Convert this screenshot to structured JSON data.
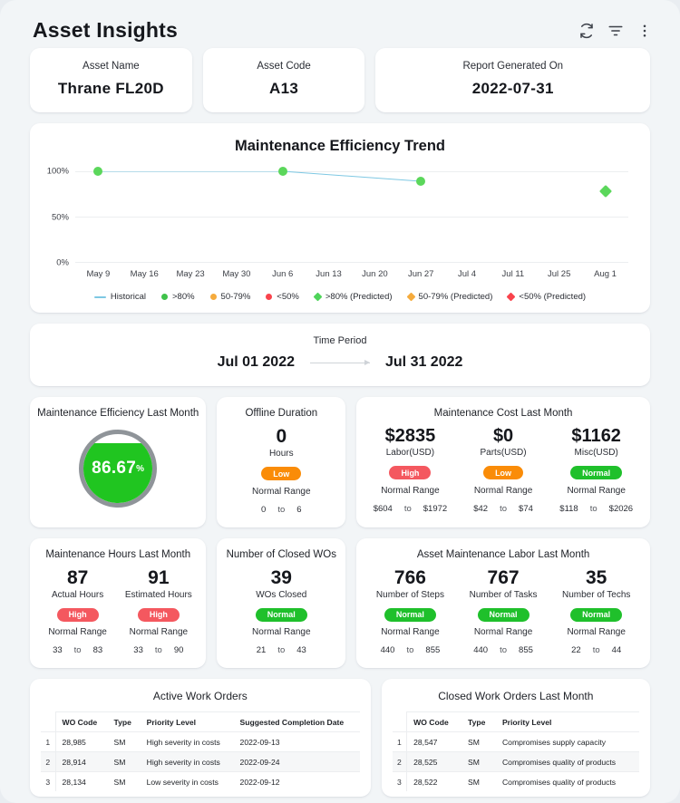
{
  "header": {
    "title": "Asset Insights",
    "actions": [
      {
        "name": "refresh-icon",
        "label": "Refresh"
      },
      {
        "name": "filter-icon",
        "label": "Filter"
      },
      {
        "name": "more-options-icon",
        "label": "More options"
      }
    ]
  },
  "info_cards": [
    {
      "label": "Asset Name",
      "value": "Thrane FL20D"
    },
    {
      "label": "Asset Code",
      "value": "A13"
    },
    {
      "label": "Report Generated On",
      "value": "2022-07-31"
    }
  ],
  "chart_data": {
    "type": "line",
    "title": "Maintenance Efficiency Trend",
    "xlabel": "",
    "ylabel": "",
    "ylim": [
      0,
      100
    ],
    "yticks": [
      "0%",
      "50%",
      "100%"
    ],
    "grid": true,
    "categories": [
      "May 9",
      "May 16",
      "May 23",
      "May 30",
      "Jun 6",
      "Jun 13",
      "Jun 20",
      "Jun 27",
      "Jul 4",
      "Jul 11",
      "Jul 25",
      "Aug 1"
    ],
    "series": [
      {
        "name": "Historical",
        "type": "line",
        "color": "#7ec8e3",
        "points": [
          {
            "x": "May 9",
            "y": 100,
            "marker": "circle",
            "color": "#5bd75b",
            "band": ">80%"
          },
          {
            "x": "Jun 6",
            "y": 100,
            "marker": "circle",
            "color": "#5bd75b",
            "band": ">80%"
          },
          {
            "x": "Jun 27",
            "y": 89,
            "marker": "circle",
            "color": "#5bd75b",
            "band": ">80%"
          }
        ]
      },
      {
        "name": "Predicted",
        "type": "scatter",
        "points": [
          {
            "x": "Aug 1",
            "y": 78,
            "marker": "diamond",
            "color": "#5bd75b",
            "band": ">80% (Predicted)"
          }
        ]
      }
    ],
    "legend_position": "bottom",
    "legend": [
      {
        "label": "Historical",
        "marker": "line",
        "color": "#7ec8e3"
      },
      {
        "label": ">80%",
        "marker": "dot",
        "color": "#3fc24a"
      },
      {
        "label": "50-79%",
        "marker": "dot",
        "color": "#f5ab3d"
      },
      {
        "label": "<50%",
        "marker": "dot",
        "color": "#f9434c"
      },
      {
        "label": ">80% (Predicted)",
        "marker": "diamond",
        "color": "#4fd45a"
      },
      {
        "label": "50-79% (Predicted)",
        "marker": "diamond",
        "color": "#f5ab3d"
      },
      {
        "label": "<50% (Predicted)",
        "marker": "diamond",
        "color": "#f9434c"
      }
    ]
  },
  "time_period": {
    "label": "Time Period",
    "start": "Jul 01 2022",
    "end": "Jul 31 2022"
  },
  "efficiency_card": {
    "title": "Maintenance Efficiency Last Month",
    "value": "86.67",
    "unit": "%",
    "percent": 86.67,
    "fill_color": "#20c520",
    "ring_color": "#8f9499"
  },
  "offline_card": {
    "title": "Offline Duration",
    "value": "0",
    "sub": "Hours",
    "badge": "Low",
    "badge_kind": "low",
    "range_label": "Normal Range",
    "min": "0",
    "to": "to",
    "max": "6"
  },
  "cost_card": {
    "title": "Maintenance Cost Last Month",
    "columns": [
      {
        "value": "$2835",
        "sub": "Labor(USD)",
        "badge": "High",
        "badge_kind": "high",
        "range_label": "Normal Range",
        "min": "$604",
        "to": "to",
        "max": "$1972"
      },
      {
        "value": "$0",
        "sub": "Parts(USD)",
        "badge": "Low",
        "badge_kind": "low",
        "range_label": "Normal Range",
        "min": "$42",
        "to": "to",
        "max": "$74"
      },
      {
        "value": "$1162",
        "sub": "Misc(USD)",
        "badge": "Normal",
        "badge_kind": "normal",
        "range_label": "Normal Range",
        "min": "$118",
        "to": "to",
        "max": "$2026"
      }
    ]
  },
  "hours_card": {
    "title": "Maintenance Hours Last Month",
    "columns": [
      {
        "value": "87",
        "sub": "Actual Hours",
        "badge": "High",
        "badge_kind": "high",
        "range_label": "Normal Range",
        "min": "33",
        "to": "to",
        "max": "83"
      },
      {
        "value": "91",
        "sub": "Estimated Hours",
        "badge": "High",
        "badge_kind": "high",
        "range_label": "Normal Range",
        "min": "33",
        "to": "to",
        "max": "90"
      }
    ]
  },
  "closed_wos_card": {
    "title": "Number of Closed WOs",
    "columns": [
      {
        "value": "39",
        "sub": "WOs Closed",
        "badge": "Normal",
        "badge_kind": "normal",
        "range_label": "Normal Range",
        "min": "21",
        "to": "to",
        "max": "43"
      }
    ]
  },
  "labor_card": {
    "title": "Asset Maintenance Labor Last Month",
    "columns": [
      {
        "value": "766",
        "sub": "Number of Steps",
        "badge": "Normal",
        "badge_kind": "normal",
        "range_label": "Normal Range",
        "min": "440",
        "to": "to",
        "max": "855"
      },
      {
        "value": "767",
        "sub": "Number of Tasks",
        "badge": "Normal",
        "badge_kind": "normal",
        "range_label": "Normal Range",
        "min": "440",
        "to": "to",
        "max": "855"
      },
      {
        "value": "35",
        "sub": "Number of Techs",
        "badge": "Normal",
        "badge_kind": "normal",
        "range_label": "Normal Range",
        "min": "22",
        "to": "to",
        "max": "44"
      }
    ]
  },
  "active_wo_table": {
    "title": "Active Work Orders",
    "columns": [
      "",
      "WO Code",
      "Type",
      "Priority Level",
      "Suggested Completion Date"
    ],
    "rows": [
      [
        "1",
        "28,985",
        "SM",
        "High severity in costs",
        "2022-09-13"
      ],
      [
        "2",
        "28,914",
        "SM",
        "High severity in costs",
        "2022-09-24"
      ],
      [
        "3",
        "28,134",
        "SM",
        "Low severity in costs",
        "2022-09-12"
      ]
    ]
  },
  "closed_wo_table": {
    "title": "Closed Work Orders Last Month",
    "columns": [
      "",
      "WO Code",
      "Type",
      "Priority Level"
    ],
    "rows": [
      [
        "1",
        "28,547",
        "SM",
        "Compromises supply capacity"
      ],
      [
        "2",
        "28,525",
        "SM",
        "Compromises quality of products"
      ],
      [
        "3",
        "28,522",
        "SM",
        "Compromises quality of products"
      ]
    ]
  }
}
